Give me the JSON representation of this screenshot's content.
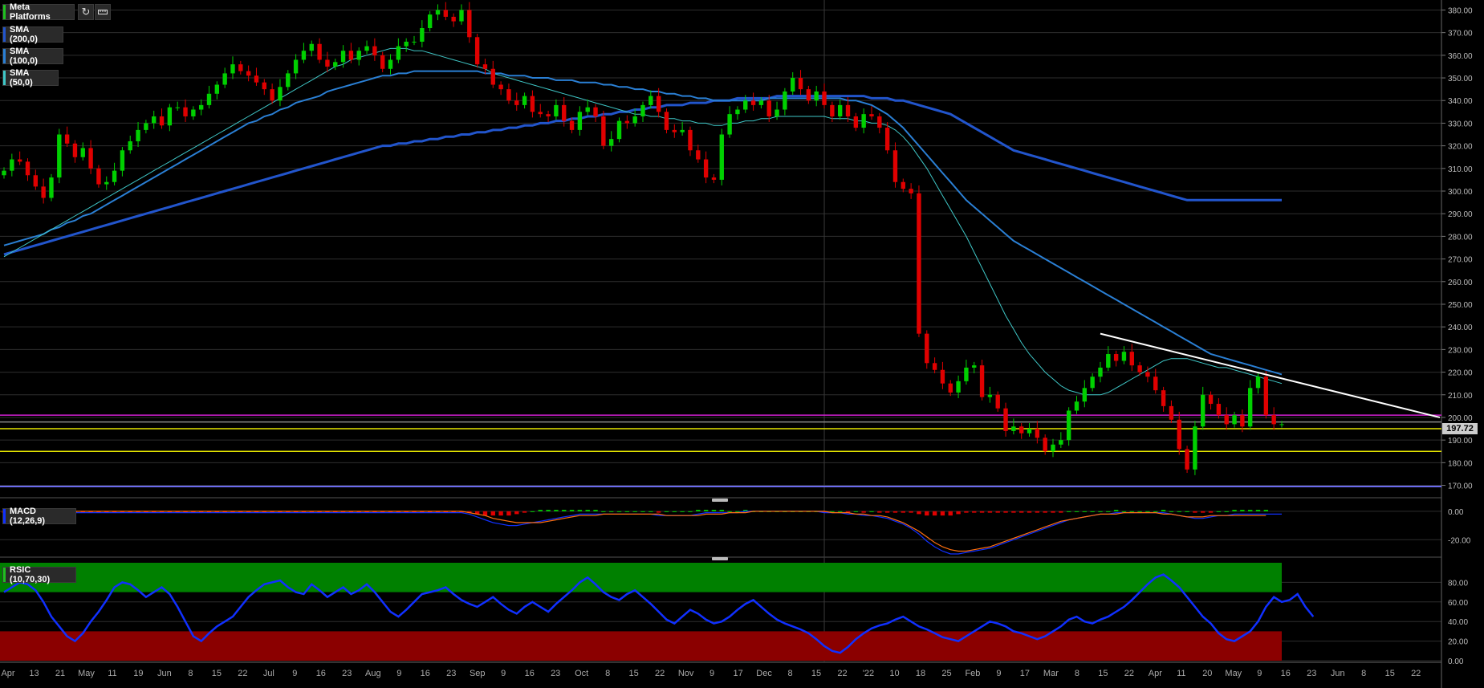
{
  "panels": {
    "main": {
      "instrument": "Meta Platforms",
      "legend": [
        {
          "label": "SMA (200,0)",
          "color": "#2255cc"
        },
        {
          "label": "SMA (100,0)",
          "color": "#2a7fd4"
        },
        {
          "label": "SMA (50,0)",
          "color": "#3fc7c7"
        }
      ],
      "toolbar": {
        "refresh_icon": "refresh-icon",
        "ruler_icon": "ruler-icon"
      },
      "last_price": "197.72"
    },
    "macd": {
      "label": "MACD (12,26,9)"
    },
    "rsi": {
      "label": "RSIC (10,70,30)"
    }
  },
  "colors": {
    "up": "#00d000",
    "down": "#e00000",
    "sma50": "#3fc7c7",
    "sma100": "#2a7fd4",
    "sma200": "#2255cc",
    "magenta": "#d020d0",
    "yellow": "#e6e600",
    "white": "#ffffff",
    "purple": "#6a6aee",
    "rsi_line": "#1030ff",
    "macd_line": "#1030ff",
    "signal_line": "#ff7010"
  },
  "chart_data": [
    {
      "type": "candlestick",
      "title": "Meta Platforms",
      "ylim": [
        167,
        383
      ],
      "y_ticks": [
        "170.00",
        "180.00",
        "190.00",
        "200.00",
        "210.00",
        "220.00",
        "230.00",
        "240.00",
        "250.00",
        "260.00",
        "270.00",
        "280.00",
        "290.00",
        "300.00",
        "310.00",
        "320.00",
        "330.00",
        "340.00",
        "350.00",
        "360.00",
        "370.00",
        "380.00"
      ],
      "x_ticks": [
        "Apr",
        "13",
        "21",
        "May",
        "11",
        "19",
        "Jun",
        "8",
        "15",
        "22",
        "Jul",
        "9",
        "16",
        "23",
        "Aug",
        "9",
        "16",
        "23",
        "Sep",
        "9",
        "16",
        "23",
        "Oct",
        "8",
        "15",
        "22",
        "Nov",
        "9",
        "17",
        "Dec",
        "8",
        "15",
        "22",
        "'22",
        "10",
        "18",
        "25",
        "Feb",
        "9",
        "17",
        "Mar",
        "8",
        "15",
        "22",
        "Apr",
        "11",
        "20",
        "May",
        "9",
        "16",
        "23",
        "Jun",
        "8",
        "15",
        "22"
      ],
      "closes": [
        309,
        314,
        313,
        307,
        302,
        297,
        306,
        325,
        321,
        315,
        319,
        310,
        303,
        304,
        309,
        318,
        322,
        327,
        330,
        333,
        329,
        337,
        337,
        333,
        336,
        338,
        343,
        347,
        352,
        356,
        353,
        351,
        348,
        345,
        340,
        346,
        352,
        358,
        362,
        365,
        358,
        355,
        357,
        362,
        358,
        362,
        364,
        360,
        354,
        358,
        364,
        366,
        366,
        372,
        378,
        380,
        377,
        375,
        380,
        368,
        356,
        354,
        347,
        345,
        340,
        338,
        342,
        335,
        334,
        333,
        338,
        331,
        327,
        335,
        337,
        333,
        320,
        323,
        331,
        330,
        333,
        338,
        342,
        335,
        327,
        326,
        327,
        318,
        314,
        306,
        305,
        325,
        334,
        336,
        340,
        338,
        340,
        333,
        336,
        344,
        350,
        345,
        340,
        344,
        338,
        333,
        338,
        333,
        328,
        334,
        333,
        328,
        318,
        304,
        301,
        299,
        237,
        224,
        221,
        215,
        211,
        216,
        222,
        223,
        209,
        210,
        204,
        194,
        196,
        193,
        195,
        191,
        185,
        188,
        190,
        203,
        207,
        213,
        218,
        222,
        228,
        225,
        229,
        223,
        220,
        218,
        212,
        205,
        199,
        186,
        177,
        196,
        210,
        206,
        201,
        197,
        201,
        196,
        213,
        218,
        201,
        197,
        197
      ],
      "sma_50": [
        271,
        273,
        275,
        277,
        279,
        281,
        283,
        285,
        287,
        289,
        291,
        293,
        295,
        297,
        299,
        301,
        303,
        305,
        307,
        309,
        311,
        313,
        315,
        317,
        319,
        321,
        323,
        325,
        327,
        329,
        331,
        333,
        335,
        337,
        339,
        341,
        343,
        345,
        347,
        349,
        351,
        353,
        355,
        356,
        358,
        359,
        360,
        361,
        362,
        363,
        363,
        363,
        362,
        362,
        361,
        360,
        359,
        358,
        357,
        356,
        355,
        354,
        352,
        351,
        350,
        349,
        348,
        347,
        346,
        345,
        344,
        343,
        342,
        341,
        340,
        339,
        338,
        337,
        336,
        335,
        334,
        334,
        333,
        333,
        332,
        332,
        331,
        331,
        330,
        330,
        329,
        329,
        330,
        330,
        331,
        331,
        332,
        332,
        333,
        333,
        333,
        333,
        333,
        333,
        333,
        332,
        332,
        332,
        331,
        331,
        330,
        330,
        329,
        327,
        324,
        320,
        315,
        310,
        304,
        298,
        292,
        286,
        280,
        273,
        266,
        259,
        252,
        245,
        239,
        233,
        228,
        224,
        220,
        217,
        214,
        212,
        211,
        210,
        210,
        210,
        211,
        213,
        215,
        217,
        219,
        221,
        223,
        225,
        226,
        226,
        226,
        225,
        224,
        223,
        222,
        222,
        221,
        220,
        219,
        218,
        217,
        216,
        215
      ],
      "sma_100": [
        276,
        277,
        278,
        279,
        280,
        281,
        283,
        284,
        286,
        287,
        289,
        290,
        292,
        294,
        296,
        298,
        300,
        302,
        304,
        306,
        308,
        310,
        312,
        314,
        316,
        318,
        320,
        322,
        324,
        326,
        328,
        330,
        331,
        333,
        334,
        336,
        337,
        339,
        340,
        341,
        342,
        344,
        345,
        346,
        347,
        348,
        349,
        350,
        351,
        351,
        352,
        352,
        353,
        353,
        353,
        353,
        353,
        353,
        353,
        353,
        353,
        352,
        352,
        352,
        351,
        351,
        351,
        350,
        350,
        350,
        349,
        349,
        349,
        348,
        348,
        348,
        347,
        347,
        346,
        346,
        345,
        345,
        344,
        344,
        343,
        343,
        342,
        342,
        341,
        341,
        340,
        340,
        340,
        340,
        340,
        340,
        340,
        341,
        341,
        341,
        341,
        341,
        341,
        341,
        341,
        341,
        341,
        340,
        340,
        339,
        338,
        336,
        334,
        331,
        328,
        324,
        320,
        316,
        312,
        308,
        304,
        300,
        296,
        293,
        290,
        287,
        284,
        281,
        278,
        276,
        274,
        272,
        270,
        268,
        266,
        264,
        262,
        260,
        258,
        256,
        254,
        252,
        250,
        248,
        246,
        244,
        242,
        240,
        238,
        236,
        234,
        232,
        230,
        228,
        227,
        226,
        225,
        224,
        223,
        222,
        221,
        220,
        219
      ],
      "sma_200": [
        272,
        273,
        274,
        275,
        276,
        277,
        278,
        279,
        280,
        281,
        282,
        283,
        284,
        285,
        286,
        287,
        288,
        289,
        290,
        291,
        292,
        293,
        294,
        295,
        296,
        297,
        298,
        299,
        300,
        301,
        302,
        303,
        304,
        305,
        306,
        307,
        308,
        309,
        310,
        311,
        312,
        313,
        314,
        315,
        316,
        317,
        318,
        319,
        320,
        320,
        321,
        321,
        322,
        322,
        323,
        323,
        324,
        324,
        325,
        325,
        326,
        326,
        327,
        327,
        328,
        328,
        329,
        329,
        330,
        330,
        331,
        331,
        332,
        332,
        333,
        333,
        334,
        334,
        335,
        335,
        336,
        336,
        337,
        337,
        338,
        338,
        338,
        339,
        339,
        339,
        340,
        340,
        340,
        341,
        341,
        341,
        341,
        341,
        342,
        342,
        342,
        342,
        342,
        342,
        342,
        342,
        342,
        342,
        342,
        342,
        341,
        341,
        341,
        340,
        340,
        339,
        338,
        337,
        336,
        335,
        334,
        332,
        330,
        328,
        326,
        324,
        322,
        320,
        318,
        317,
        316,
        315,
        314,
        313,
        312,
        311,
        310,
        309,
        308,
        307,
        306,
        305,
        304,
        303,
        302,
        301,
        300,
        299,
        298,
        297,
        296,
        296,
        296,
        296,
        296,
        296,
        296,
        296,
        296,
        296,
        296,
        296,
        296
      ],
      "horizontal_lines": [
        {
          "value": 201,
          "color": "#d020d0"
        },
        {
          "value": 198,
          "color": "#888888"
        },
        {
          "value": 195,
          "color": "#e6e600"
        },
        {
          "value": 185,
          "color": "#e6e600"
        },
        {
          "value": 169.5,
          "color": "#6a6aee"
        }
      ],
      "trendline": {
        "from": [
          139,
          237
        ],
        "to": [
          163,
          200
        ],
        "color": "#ffffff"
      },
      "vertical_marker_index": 104
    },
    {
      "type": "line",
      "title": "MACD (12,26,9)",
      "ylim": [
        -30,
        5
      ],
      "y_ticks": [
        "0.00",
        "-20.00"
      ],
      "macd": [
        -1,
        -1,
        -1,
        -1,
        -1,
        -1,
        -1,
        -1,
        -1,
        -1,
        -1,
        -1,
        -1,
        -1,
        -1,
        -1,
        -1,
        -1,
        -1,
        -1,
        -1,
        -1,
        -1,
        -1,
        -1,
        -1,
        -1,
        -1,
        -1,
        -1,
        -1,
        -1,
        -1,
        -1,
        -1,
        -1,
        -1,
        -1,
        -1,
        -1,
        -1,
        -1,
        -1,
        -1,
        -1,
        -1,
        -1,
        -1,
        -1,
        -1,
        -1,
        -1,
        -1,
        -1,
        -1,
        -1,
        -1,
        -1,
        -1,
        -2,
        -4,
        -6,
        -8,
        -9,
        -10,
        -10,
        -9,
        -8,
        -7,
        -6,
        -5,
        -4,
        -3,
        -2,
        -2,
        -2,
        -2,
        -2,
        -2,
        -2,
        -2,
        -2,
        -2,
        -3,
        -3,
        -3,
        -3,
        -3,
        -2,
        -1,
        -1,
        -1,
        -1,
        -1,
        0,
        0,
        0,
        0,
        0,
        0,
        0,
        0,
        0,
        0,
        -1,
        -1,
        -1,
        -2,
        -2,
        -3,
        -3,
        -4,
        -5,
        -7,
        -9,
        -12,
        -16,
        -21,
        -25,
        -28,
        -30,
        -30,
        -29,
        -28,
        -27,
        -26,
        -24,
        -22,
        -20,
        -18,
        -16,
        -14,
        -12,
        -10,
        -8,
        -6,
        -5,
        -4,
        -3,
        -2,
        -2,
        -1,
        -1,
        -1,
        -1,
        -1,
        -1,
        -1,
        -2,
        -3,
        -4,
        -5,
        -5,
        -4,
        -3,
        -3,
        -2,
        -2,
        -2,
        -2,
        -2,
        -2,
        -2
      ],
      "signal": [
        0,
        0,
        0,
        0,
        0,
        0,
        0,
        0,
        0,
        0,
        0,
        0,
        0,
        0,
        0,
        0,
        0,
        0,
        0,
        0,
        0,
        0,
        0,
        0,
        0,
        0,
        0,
        0,
        0,
        0,
        0,
        0,
        0,
        0,
        0,
        0,
        0,
        0,
        0,
        0,
        0,
        0,
        0,
        0,
        0,
        0,
        0,
        0,
        0,
        0,
        0,
        0,
        0,
        0,
        0,
        0,
        0,
        0,
        0,
        -1,
        -2,
        -3,
        -5,
        -6,
        -7,
        -8,
        -8,
        -8,
        -8,
        -7,
        -6,
        -5,
        -4,
        -3,
        -3,
        -3,
        -2,
        -2,
        -2,
        -2,
        -2,
        -2,
        -2,
        -2,
        -3,
        -3,
        -3,
        -3,
        -3,
        -2,
        -2,
        -2,
        -1,
        -1,
        -1,
        0,
        0,
        0,
        0,
        0,
        0,
        0,
        0,
        0,
        0,
        -1,
        -1,
        -1,
        -2,
        -2,
        -3,
        -3,
        -4,
        -6,
        -8,
        -11,
        -14,
        -18,
        -22,
        -25,
        -27,
        -28,
        -28,
        -27,
        -26,
        -25,
        -23,
        -21,
        -19,
        -17,
        -15,
        -13,
        -11,
        -9,
        -7,
        -6,
        -5,
        -4,
        -3,
        -2,
        -2,
        -2,
        -1,
        -1,
        -1,
        -1,
        -1,
        -2,
        -2,
        -3,
        -4,
        -4,
        -4,
        -3,
        -3,
        -3,
        -3,
        -3,
        -3,
        -3,
        -3
      ]
    },
    {
      "type": "line",
      "title": "RSIC (10,70,30)",
      "ylim": [
        0,
        100
      ],
      "y_ticks": [
        "0.00",
        "20.00",
        "40.00",
        "60.00",
        "80.00"
      ],
      "overbought": 70,
      "oversold": 30,
      "values": [
        70,
        75,
        80,
        78,
        72,
        60,
        45,
        35,
        25,
        20,
        28,
        40,
        50,
        62,
        75,
        80,
        78,
        72,
        65,
        70,
        75,
        68,
        55,
        40,
        25,
        20,
        28,
        35,
        40,
        45,
        55,
        65,
        72,
        78,
        80,
        82,
        75,
        70,
        68,
        78,
        72,
        65,
        70,
        75,
        68,
        72,
        78,
        70,
        60,
        50,
        45,
        52,
        60,
        68,
        70,
        72,
        75,
        68,
        62,
        58,
        55,
        60,
        65,
        58,
        52,
        48,
        55,
        60,
        55,
        50,
        58,
        65,
        72,
        80,
        85,
        78,
        70,
        65,
        62,
        68,
        72,
        65,
        58,
        50,
        42,
        38,
        45,
        52,
        48,
        42,
        38,
        40,
        45,
        52,
        58,
        62,
        55,
        48,
        42,
        38,
        35,
        32,
        28,
        22,
        15,
        10,
        8,
        14,
        22,
        28,
        33,
        36,
        38,
        42,
        45,
        40,
        35,
        32,
        28,
        24,
        22,
        20,
        25,
        30,
        35,
        40,
        38,
        35,
        30,
        28,
        25,
        22,
        25,
        30,
        35,
        42,
        45,
        40,
        38,
        42,
        45,
        50,
        55,
        62,
        70,
        78,
        85,
        88,
        82,
        75,
        65,
        55,
        45,
        38,
        28,
        22,
        20,
        25,
        30,
        40,
        55,
        65,
        60,
        62,
        68,
        55,
        45
      ]
    }
  ]
}
